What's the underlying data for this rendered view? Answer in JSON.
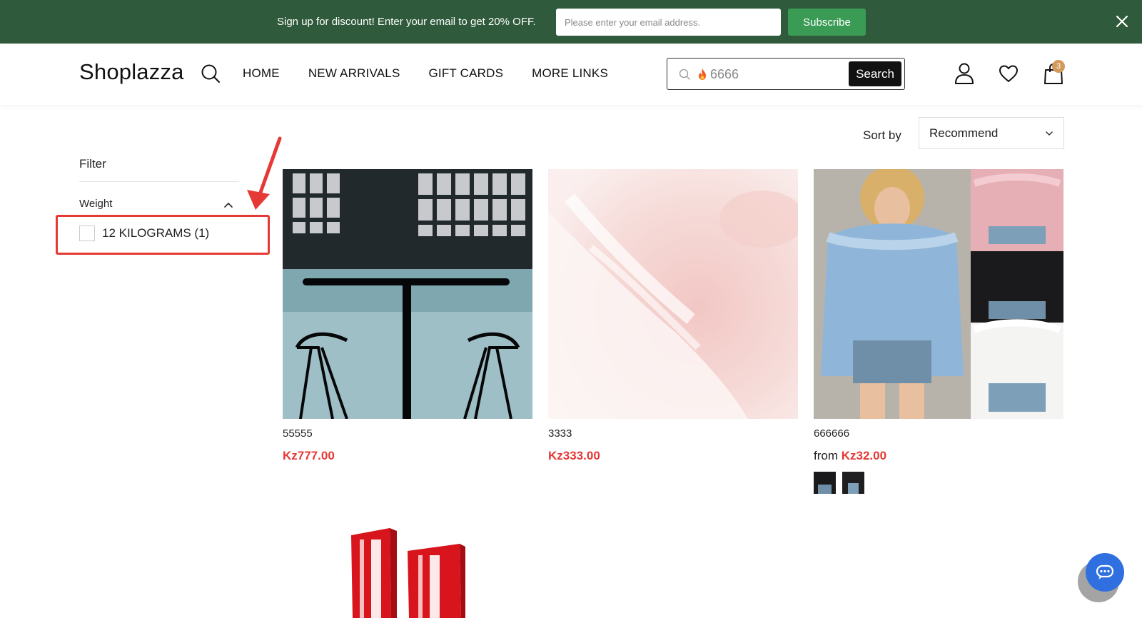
{
  "announcement": {
    "text": "Sign up for discount! Enter your email to get 20% OFF.",
    "email_placeholder": "Please enter your email address.",
    "subscribe_label": "Subscribe",
    "close_icon": "close-icon"
  },
  "header": {
    "logo": "Shoplazza",
    "nav": [
      {
        "label": "HOME"
      },
      {
        "label": "NEW ARRIVALS"
      },
      {
        "label": "GIFT CARDS"
      },
      {
        "label": "MORE LINKS"
      }
    ],
    "search": {
      "value": "6666",
      "button_label": "Search"
    },
    "cart_count": "3",
    "icons": [
      "search-icon",
      "user-icon",
      "heart-icon",
      "cart-icon"
    ]
  },
  "sort": {
    "label": "Sort by",
    "selected": "Recommend"
  },
  "filter": {
    "title": "Filter",
    "groups": [
      {
        "name": "Weight",
        "options": [
          {
            "label": "12 KILOGRAMS (1)",
            "checked": false
          }
        ]
      }
    ]
  },
  "products": [
    {
      "title": "55555",
      "price": "Kz777.00",
      "from": ""
    },
    {
      "title": "3333",
      "price": "Kz333.00",
      "from": ""
    },
    {
      "title": "666666",
      "price": "Kz32.00",
      "from": "from "
    },
    {
      "title": "",
      "price": "",
      "from": ""
    }
  ],
  "colors": {
    "announce_bg": "#2f5a3b",
    "subscribe_bg": "#3a9b55",
    "price": "#e53935",
    "highlight": "#e53935",
    "cart_badge": "#d39a5c",
    "chat": "#2f6fe0"
  }
}
